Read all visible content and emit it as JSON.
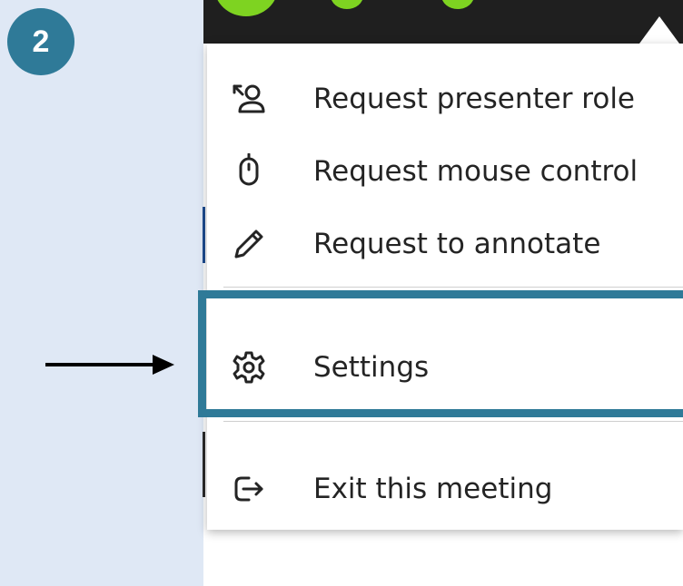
{
  "step": {
    "number": "2",
    "color": "#2f7a98"
  },
  "annotation": {
    "arrow_icon": "arrow-right-icon",
    "highlight_color": "#2f7a98",
    "highlighted_item": "settings"
  },
  "menu": {
    "items": [
      {
        "id": "request-presenter",
        "icon": "presenter-request-icon",
        "label": "Request presenter role"
      },
      {
        "id": "request-mouse",
        "icon": "mouse-icon",
        "label": "Request mouse control"
      },
      {
        "id": "request-annotate",
        "icon": "pencil-icon",
        "label": "Request to annotate"
      },
      {
        "id": "settings",
        "icon": "gear-icon",
        "label": "Settings"
      },
      {
        "id": "exit-meeting",
        "icon": "exit-icon",
        "label": "Exit this meeting"
      }
    ]
  },
  "colors": {
    "left_panel": "#dfe8f5",
    "topbar": "#1f1f1f",
    "accent_green": "#7ed321",
    "menu_text": "#242424"
  }
}
